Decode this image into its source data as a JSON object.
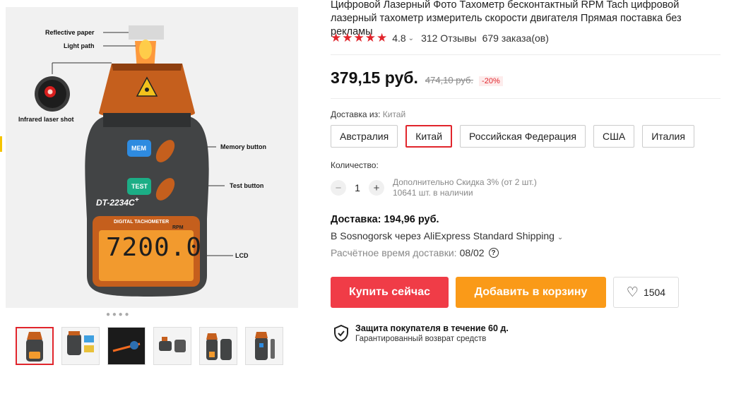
{
  "product": {
    "title": "Цифровой Лазерный Фото Тахометр бесконтактный RPM Tach цифровой лазерный тахометр измеритель скорости двигателя Прямая поставка без рекламы",
    "stars": "★★★★★",
    "rating": "4.8",
    "reviews": "312 Отзывы",
    "orders": "679 заказа(ов)"
  },
  "price": {
    "current": "379,15 руб.",
    "old": "474,10 руб.",
    "discount": "-20%"
  },
  "shipping_from": {
    "label": "Доставка из:",
    "value": "Китай",
    "options": [
      "Австралия",
      "Китай",
      "Российская Федерация",
      "США",
      "Италия"
    ],
    "selected": "Китай"
  },
  "quantity": {
    "label": "Количество:",
    "value": "1",
    "minus": "−",
    "plus": "+",
    "extra_discount": "Дополнительно Скидка 3% (от 2 шт.)",
    "stock": "10641 шт. в наличии"
  },
  "delivery": {
    "cost": "Доставка: 194,96 руб.",
    "method": "В Sosnogorsk через AliExpress Standard Shipping",
    "eta_label": "Расчётное время доставки:",
    "eta_value": "08/02"
  },
  "actions": {
    "buy": "Купить сейчас",
    "cart": "Добавить в корзину",
    "wishlist_count": "1504"
  },
  "protection": {
    "title": "Защита покупателя в течение 60 д.",
    "subtitle": "Гарантированный возврат средств"
  },
  "image_labels": {
    "reflective": "Reflective paper",
    "light": "Light path",
    "infrared": "Infrared laser shot",
    "memory": "Memory button",
    "test": "Test button",
    "lcd": "LCD",
    "model": "DT-2234C",
    "model_plus": "+",
    "brand": "DIGITAL TACHOMETER",
    "rpm": "RPM",
    "reading": "7200.0",
    "mem_btn": "MEM",
    "test_btn": "TEST"
  },
  "colors": {
    "accent": "#e1252c",
    "buy": "#f03c47",
    "cart": "#fa9a18",
    "device_orange": "#c55f1d",
    "lcd": "#f29a2e"
  }
}
